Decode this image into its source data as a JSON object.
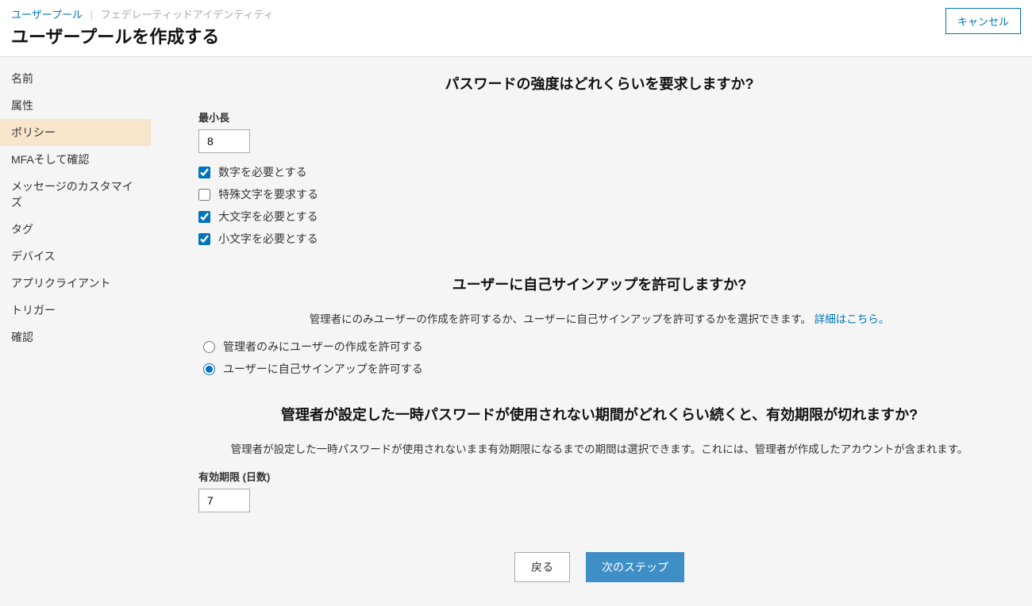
{
  "breadcrumb": {
    "link": "ユーザープール",
    "current": "フェデレーティッドアイデンティティ"
  },
  "page_title": "ユーザープールを作成する",
  "cancel_label": "キャンセル",
  "sidebar": {
    "items": [
      {
        "label": "名前"
      },
      {
        "label": "属性"
      },
      {
        "label": "ポリシー"
      },
      {
        "label": "MFAそして確認"
      },
      {
        "label": "メッセージのカスタマイズ"
      },
      {
        "label": "タグ"
      },
      {
        "label": "デバイス"
      },
      {
        "label": "アプリクライアント"
      },
      {
        "label": "トリガー"
      },
      {
        "label": "確認"
      }
    ],
    "active_index": 2
  },
  "password_section": {
    "title": "パスワードの強度はどれくらいを要求しますか?",
    "min_length_label": "最小長",
    "min_length_value": "8",
    "checkboxes": [
      {
        "label": "数字を必要とする",
        "checked": true
      },
      {
        "label": "特殊文字を要求する",
        "checked": false
      },
      {
        "label": "大文字を必要とする",
        "checked": true
      },
      {
        "label": "小文字を必要とする",
        "checked": true
      }
    ]
  },
  "signup_section": {
    "title": "ユーザーに自己サインアップを許可しますか?",
    "desc": "管理者にのみユーザーの作成を許可するか、ユーザーに自己サインアップを許可するかを選択できます。",
    "link": "詳細はこちら。",
    "radios": [
      {
        "label": "管理者のみにユーザーの作成を許可する",
        "checked": false
      },
      {
        "label": "ユーザーに自己サインアップを許可する",
        "checked": true
      }
    ]
  },
  "expire_section": {
    "title": "管理者が設定した一時パスワードが使用されない期間がどれくらい続くと、有効期限が切れますか?",
    "desc": "管理者が設定した一時パスワードが使用されないまま有効期限になるまでの期間は選択できます。これには、管理者が作成したアカウントが含まれます。",
    "days_label": "有効期限 (日数)",
    "days_value": "7"
  },
  "footer": {
    "back": "戻る",
    "next": "次のステップ"
  }
}
